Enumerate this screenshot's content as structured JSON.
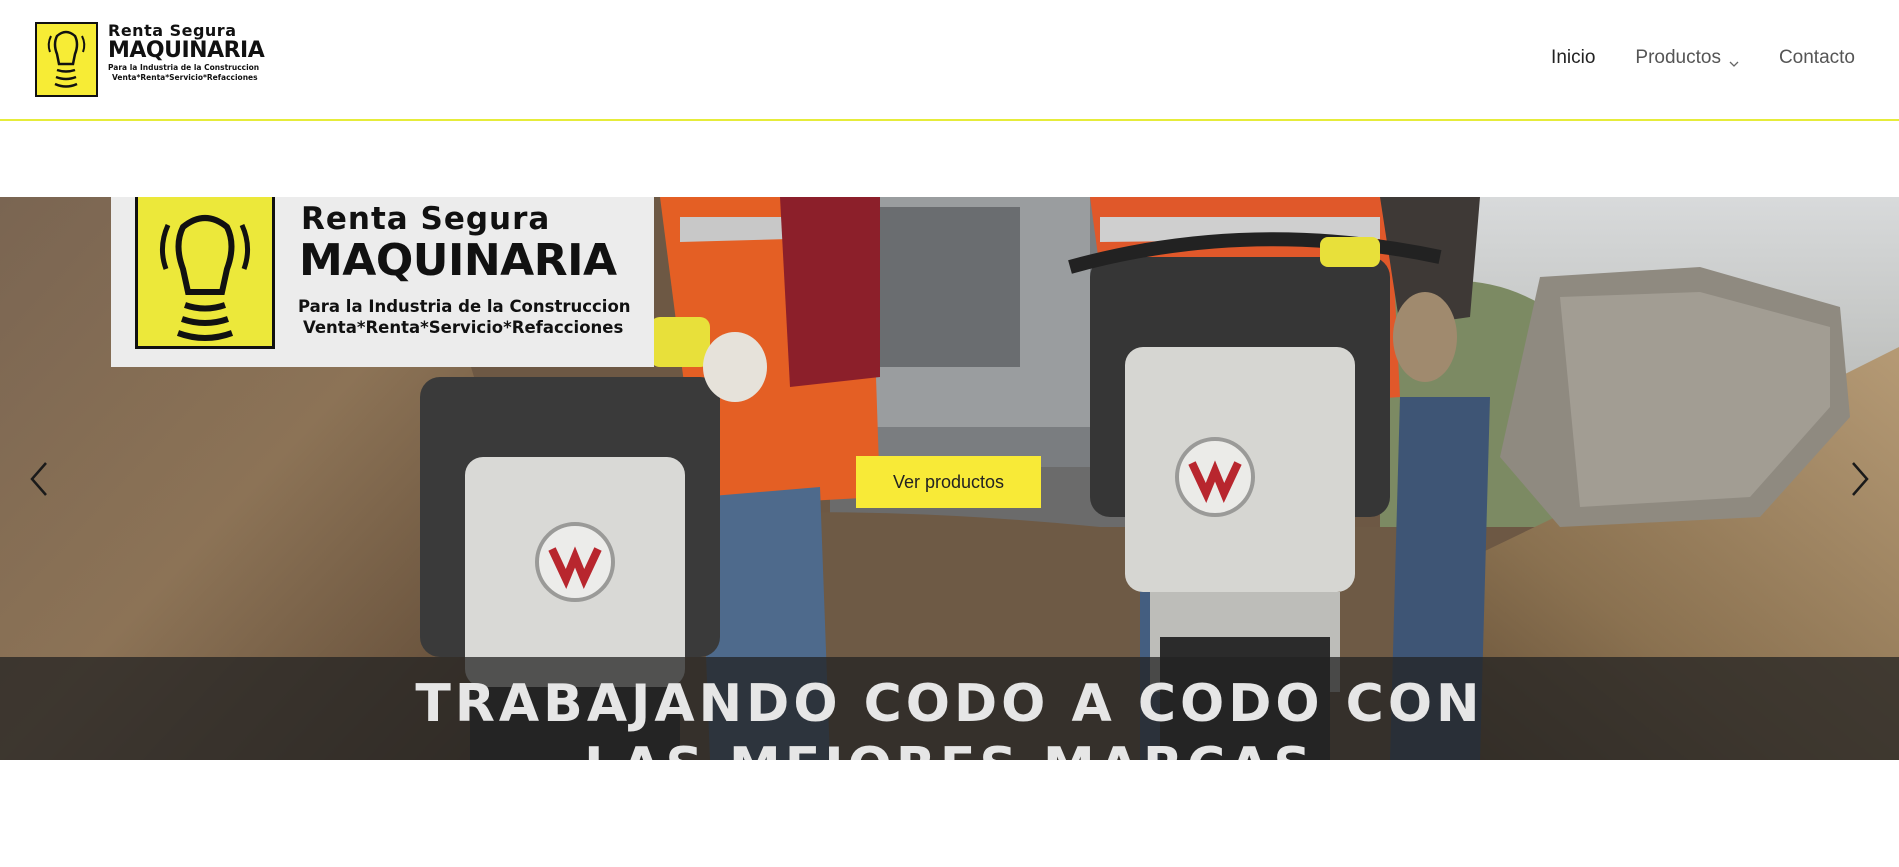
{
  "header": {
    "logo": {
      "line1": "Renta Segura",
      "line2": "MAQUINARIA",
      "line3": "Para la Industria de la Construccion",
      "line4": "Venta*Renta*Servicio*Refacciones"
    },
    "nav": [
      {
        "label": "Inicio",
        "active": true
      },
      {
        "label": "Productos",
        "has_dropdown": true
      },
      {
        "label": "Contacto"
      }
    ],
    "accent_color": "#e6ec3a"
  },
  "hero": {
    "logo": {
      "line1": "Renta Segura",
      "line2": "MAQUINARIA",
      "line3": "Para la Industria de la Construccion",
      "line4": "Venta*Renta*Servicio*Refacciones"
    },
    "cta_label": "Ver productos",
    "cta_color": "#f8ea37",
    "caption_line1": "TRABAJANDO CODO A CODO CON",
    "caption_line2": "LAS MEJORES MARCAS",
    "prev_icon": "chevron-left-icon",
    "next_icon": "chevron-right-icon"
  }
}
